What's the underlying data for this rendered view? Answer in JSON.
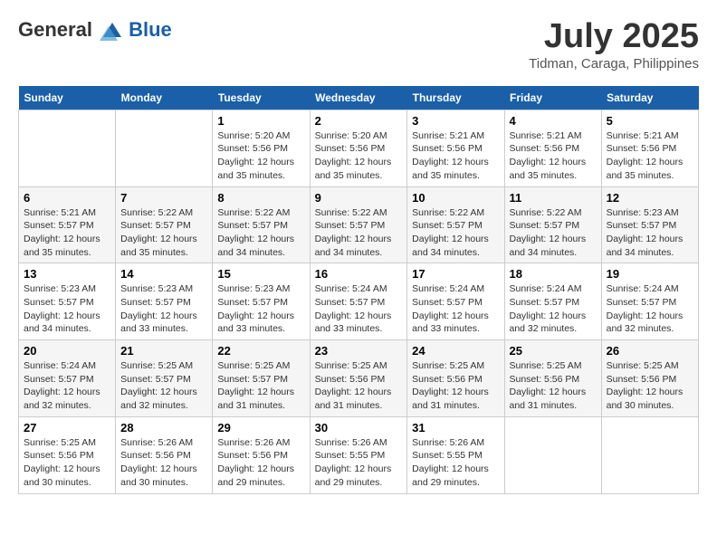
{
  "header": {
    "logo_line1": "General",
    "logo_line2": "Blue",
    "month": "July 2025",
    "location": "Tidman, Caraga, Philippines"
  },
  "days_of_week": [
    "Sunday",
    "Monday",
    "Tuesday",
    "Wednesday",
    "Thursday",
    "Friday",
    "Saturday"
  ],
  "weeks": [
    [
      {
        "day": "",
        "sunrise": "",
        "sunset": "",
        "daylight": ""
      },
      {
        "day": "",
        "sunrise": "",
        "sunset": "",
        "daylight": ""
      },
      {
        "day": "1",
        "sunrise": "Sunrise: 5:20 AM",
        "sunset": "Sunset: 5:56 PM",
        "daylight": "Daylight: 12 hours and 35 minutes."
      },
      {
        "day": "2",
        "sunrise": "Sunrise: 5:20 AM",
        "sunset": "Sunset: 5:56 PM",
        "daylight": "Daylight: 12 hours and 35 minutes."
      },
      {
        "day": "3",
        "sunrise": "Sunrise: 5:21 AM",
        "sunset": "Sunset: 5:56 PM",
        "daylight": "Daylight: 12 hours and 35 minutes."
      },
      {
        "day": "4",
        "sunrise": "Sunrise: 5:21 AM",
        "sunset": "Sunset: 5:56 PM",
        "daylight": "Daylight: 12 hours and 35 minutes."
      },
      {
        "day": "5",
        "sunrise": "Sunrise: 5:21 AM",
        "sunset": "Sunset: 5:56 PM",
        "daylight": "Daylight: 12 hours and 35 minutes."
      }
    ],
    [
      {
        "day": "6",
        "sunrise": "Sunrise: 5:21 AM",
        "sunset": "Sunset: 5:57 PM",
        "daylight": "Daylight: 12 hours and 35 minutes."
      },
      {
        "day": "7",
        "sunrise": "Sunrise: 5:22 AM",
        "sunset": "Sunset: 5:57 PM",
        "daylight": "Daylight: 12 hours and 35 minutes."
      },
      {
        "day": "8",
        "sunrise": "Sunrise: 5:22 AM",
        "sunset": "Sunset: 5:57 PM",
        "daylight": "Daylight: 12 hours and 34 minutes."
      },
      {
        "day": "9",
        "sunrise": "Sunrise: 5:22 AM",
        "sunset": "Sunset: 5:57 PM",
        "daylight": "Daylight: 12 hours and 34 minutes."
      },
      {
        "day": "10",
        "sunrise": "Sunrise: 5:22 AM",
        "sunset": "Sunset: 5:57 PM",
        "daylight": "Daylight: 12 hours and 34 minutes."
      },
      {
        "day": "11",
        "sunrise": "Sunrise: 5:22 AM",
        "sunset": "Sunset: 5:57 PM",
        "daylight": "Daylight: 12 hours and 34 minutes."
      },
      {
        "day": "12",
        "sunrise": "Sunrise: 5:23 AM",
        "sunset": "Sunset: 5:57 PM",
        "daylight": "Daylight: 12 hours and 34 minutes."
      }
    ],
    [
      {
        "day": "13",
        "sunrise": "Sunrise: 5:23 AM",
        "sunset": "Sunset: 5:57 PM",
        "daylight": "Daylight: 12 hours and 34 minutes."
      },
      {
        "day": "14",
        "sunrise": "Sunrise: 5:23 AM",
        "sunset": "Sunset: 5:57 PM",
        "daylight": "Daylight: 12 hours and 33 minutes."
      },
      {
        "day": "15",
        "sunrise": "Sunrise: 5:23 AM",
        "sunset": "Sunset: 5:57 PM",
        "daylight": "Daylight: 12 hours and 33 minutes."
      },
      {
        "day": "16",
        "sunrise": "Sunrise: 5:24 AM",
        "sunset": "Sunset: 5:57 PM",
        "daylight": "Daylight: 12 hours and 33 minutes."
      },
      {
        "day": "17",
        "sunrise": "Sunrise: 5:24 AM",
        "sunset": "Sunset: 5:57 PM",
        "daylight": "Daylight: 12 hours and 33 minutes."
      },
      {
        "day": "18",
        "sunrise": "Sunrise: 5:24 AM",
        "sunset": "Sunset: 5:57 PM",
        "daylight": "Daylight: 12 hours and 32 minutes."
      },
      {
        "day": "19",
        "sunrise": "Sunrise: 5:24 AM",
        "sunset": "Sunset: 5:57 PM",
        "daylight": "Daylight: 12 hours and 32 minutes."
      }
    ],
    [
      {
        "day": "20",
        "sunrise": "Sunrise: 5:24 AM",
        "sunset": "Sunset: 5:57 PM",
        "daylight": "Daylight: 12 hours and 32 minutes."
      },
      {
        "day": "21",
        "sunrise": "Sunrise: 5:25 AM",
        "sunset": "Sunset: 5:57 PM",
        "daylight": "Daylight: 12 hours and 32 minutes."
      },
      {
        "day": "22",
        "sunrise": "Sunrise: 5:25 AM",
        "sunset": "Sunset: 5:57 PM",
        "daylight": "Daylight: 12 hours and 31 minutes."
      },
      {
        "day": "23",
        "sunrise": "Sunrise: 5:25 AM",
        "sunset": "Sunset: 5:56 PM",
        "daylight": "Daylight: 12 hours and 31 minutes."
      },
      {
        "day": "24",
        "sunrise": "Sunrise: 5:25 AM",
        "sunset": "Sunset: 5:56 PM",
        "daylight": "Daylight: 12 hours and 31 minutes."
      },
      {
        "day": "25",
        "sunrise": "Sunrise: 5:25 AM",
        "sunset": "Sunset: 5:56 PM",
        "daylight": "Daylight: 12 hours and 31 minutes."
      },
      {
        "day": "26",
        "sunrise": "Sunrise: 5:25 AM",
        "sunset": "Sunset: 5:56 PM",
        "daylight": "Daylight: 12 hours and 30 minutes."
      }
    ],
    [
      {
        "day": "27",
        "sunrise": "Sunrise: 5:25 AM",
        "sunset": "Sunset: 5:56 PM",
        "daylight": "Daylight: 12 hours and 30 minutes."
      },
      {
        "day": "28",
        "sunrise": "Sunrise: 5:26 AM",
        "sunset": "Sunset: 5:56 PM",
        "daylight": "Daylight: 12 hours and 30 minutes."
      },
      {
        "day": "29",
        "sunrise": "Sunrise: 5:26 AM",
        "sunset": "Sunset: 5:56 PM",
        "daylight": "Daylight: 12 hours and 29 minutes."
      },
      {
        "day": "30",
        "sunrise": "Sunrise: 5:26 AM",
        "sunset": "Sunset: 5:55 PM",
        "daylight": "Daylight: 12 hours and 29 minutes."
      },
      {
        "day": "31",
        "sunrise": "Sunrise: 5:26 AM",
        "sunset": "Sunset: 5:55 PM",
        "daylight": "Daylight: 12 hours and 29 minutes."
      },
      {
        "day": "",
        "sunrise": "",
        "sunset": "",
        "daylight": ""
      },
      {
        "day": "",
        "sunrise": "",
        "sunset": "",
        "daylight": ""
      }
    ]
  ]
}
